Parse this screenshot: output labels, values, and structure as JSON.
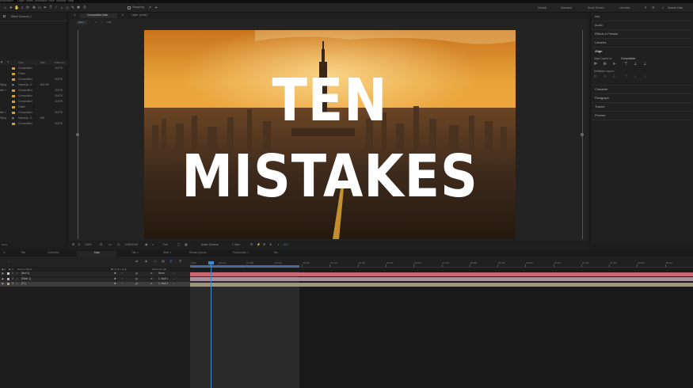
{
  "menu": [
    "omposition",
    "Layer",
    "Effect",
    "Animation",
    "View",
    "Window",
    "Help"
  ],
  "toolbar": {
    "snapping_label": "Snapping",
    "workspaces": [
      "Default",
      "Standard",
      "Small Screen",
      "Libraries"
    ],
    "search_placeholder": "Search Help"
  },
  "left_panel": {
    "tab_label": "Effect Controls 1",
    "columns": {
      "type": "Type",
      "size": "Size",
      "frame_rate": "Frame R..."
    },
    "rows": [
      {
        "name": "",
        "type": "Composition",
        "size": "",
        "rate": "23.976",
        "folder": true
      },
      {
        "name": "",
        "type": "Folder",
        "size": "",
        "rate": "",
        "folder": true
      },
      {
        "name": "",
        "type": "Composition",
        "size": "",
        "rate": "23.976",
        "folder": true
      },
      {
        "name": "Fjpeg",
        "type": "ImportJp...G",
        "size": "641 KB",
        "rate": "",
        "folder": false
      },
      {
        "name": "itler 1",
        "type": "Composition",
        "size": "",
        "rate": "23.976",
        "folder": true
      },
      {
        "name": "",
        "type": "Composition",
        "size": "",
        "rate": "23.976",
        "folder": true
      },
      {
        "name": "",
        "type": "Composition",
        "size": "",
        "rate": "23.976",
        "folder": true
      },
      {
        "name": "",
        "type": "Folder",
        "size": "",
        "rate": "",
        "folder": true
      },
      {
        "name": "itler 1",
        "type": "Composition",
        "size": "",
        "rate": "23.976",
        "folder": true
      },
      {
        "name": "Fjpeg",
        "type": "ImportJp...G",
        "size": "MB",
        "rate": "",
        "folder": false
      },
      {
        "name": "",
        "type": "Composition",
        "size": "",
        "rate": "23.976",
        "folder": true
      }
    ],
    "footer": "8 bpc"
  },
  "composition": {
    "tab_label": "Composition Main",
    "layer_tab": "Layer: (none)",
    "sub_tabs": [
      "Main",
      "T",
      "Title"
    ],
    "title_line1": "TEN",
    "title_line2": "MISTAKES",
    "viewer_controls": {
      "zoom": "100%",
      "timecode": "0:00:00:09",
      "resolution": "Full",
      "camera": "Active Camera",
      "views": "1 View",
      "exposure": "+0.0"
    }
  },
  "right_panel": {
    "items": [
      "Info",
      "Audio",
      "Effects & Presets",
      "Libraries",
      "Align",
      "Character",
      "Paragraph",
      "Tracker",
      "Preview"
    ],
    "align": {
      "align_layers_to": "Align Layers to:",
      "target": "Composition",
      "distribute_layers": "Distribute Layers:"
    }
  },
  "timeline": {
    "tabs": [
      "Title",
      "Collection",
      "Main",
      "Title 2",
      "Slide 1",
      "Render Queue",
      "Placeholder 1",
      "Title"
    ],
    "search_value": "",
    "ruler_labels": [
      "0:00f",
      "00:12f",
      "01:00f",
      "01:12f",
      "02:00f",
      "02:12f",
      "03:00f",
      "03:12f",
      "04:00f",
      "04:12f",
      "05:00f",
      "05:12f",
      "06:00f",
      "06:12f",
      "07:00f",
      "07:12f",
      "08:00f",
      "08:12f"
    ],
    "header": {
      "source_name": "Source Name",
      "parent_link": "Parent & Link"
    },
    "layers": [
      {
        "index": "1",
        "name": "[Null 1]",
        "parent": "None",
        "label_color": "#c9c9c9",
        "bar_color": "#c76874"
      },
      {
        "index": "2",
        "name": "[Slide 1]",
        "parent": "1. Null 1",
        "label_color": "#c9a2d0",
        "bar_color": "#a8919c"
      },
      {
        "index": "3",
        "name": "[T1]",
        "parent": "1. Null 1",
        "label_color": "#b6a27a",
        "bar_color": "#a09479"
      }
    ]
  },
  "colors": {
    "accent": "#3a8ad8",
    "folder": "#c9a13b",
    "work_area": "#4b6b9c"
  }
}
